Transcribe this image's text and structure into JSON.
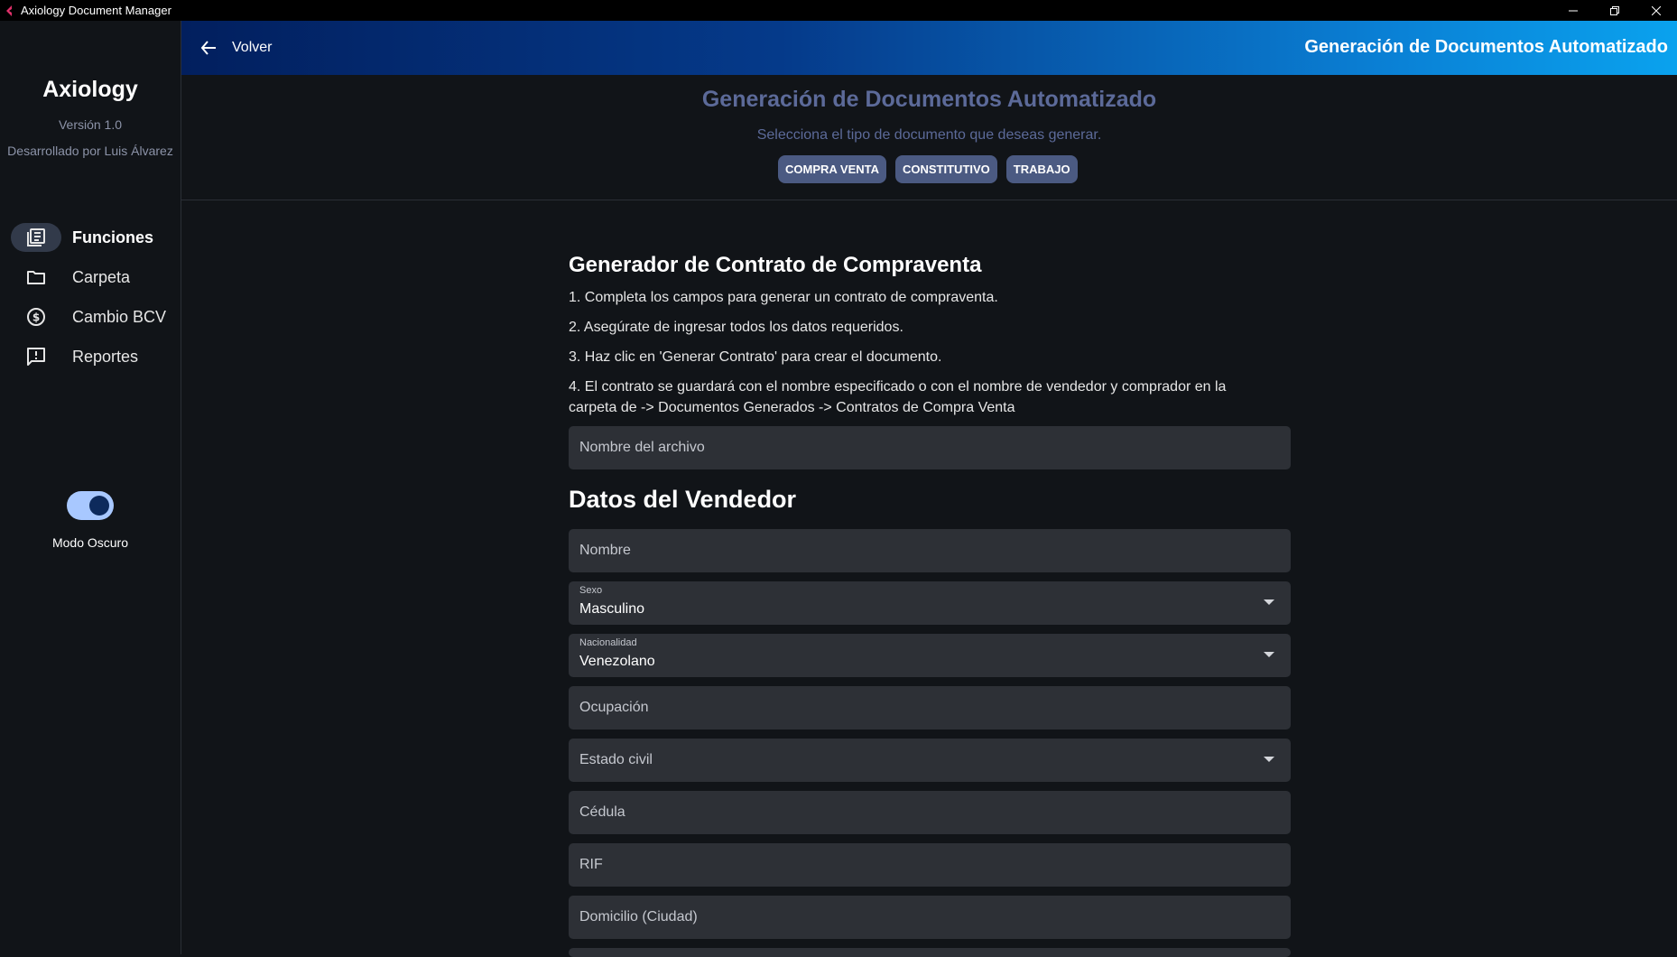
{
  "window": {
    "title": "Axiology Document Manager"
  },
  "sidebar": {
    "brand": "Axiology",
    "version": "Versión 1.0",
    "credits": "Desarrollado por Luis Álvarez",
    "items": [
      {
        "label": "Funciones",
        "icon": "library-books-icon",
        "active": true
      },
      {
        "label": "Carpeta",
        "icon": "folder-icon",
        "active": false
      },
      {
        "label": "Cambio BCV",
        "icon": "currency-icon",
        "active": false
      },
      {
        "label": "Reportes",
        "icon": "report-icon",
        "active": false
      }
    ],
    "dark_mode_label": "Modo Oscuro",
    "dark_mode_on": true
  },
  "appbar": {
    "back_label": "Volver",
    "title": "Generación de Documentos Automatizado"
  },
  "doc_types": {
    "title": "Generación de Documentos Automatizado",
    "subtitle": "Selecciona el tipo de documento que deseas generar.",
    "chips": [
      "COMPRA VENTA",
      "CONSTITUTIVO",
      "TRABAJO"
    ]
  },
  "form": {
    "title": "Generador de Contrato de Compraventa",
    "instructions": [
      "1. Completa los campos para generar un contrato de compraventa.",
      "2. Asegúrate de ingresar todos los datos requeridos.",
      "3. Haz clic en 'Generar Contrato' para crear el documento.",
      "4. El contrato se guardará con el nombre especificado o con el nombre de vendedor y comprador en la carpeta de -> Documentos Generados -> Contratos de Compra Venta"
    ],
    "filename_placeholder": "Nombre del archivo",
    "seller_section": "Datos del Vendedor",
    "name_placeholder": "Nombre",
    "sex_label": "Sexo",
    "sex_value": "Masculino",
    "nationality_label": "Nacionalidad",
    "nationality_value": "Venezolano",
    "occupation_placeholder": "Ocupación",
    "civil_status_placeholder": "Estado civil",
    "id_placeholder": "Cédula",
    "rif_placeholder": "RIF",
    "address_placeholder": "Domicilio (Ciudad)"
  },
  "colors": {
    "accent": "#4b5a82",
    "header_gradient_start": "#021f5e",
    "header_gradient_end": "#0aa2ee",
    "toggle_track": "#a8c8ff"
  }
}
